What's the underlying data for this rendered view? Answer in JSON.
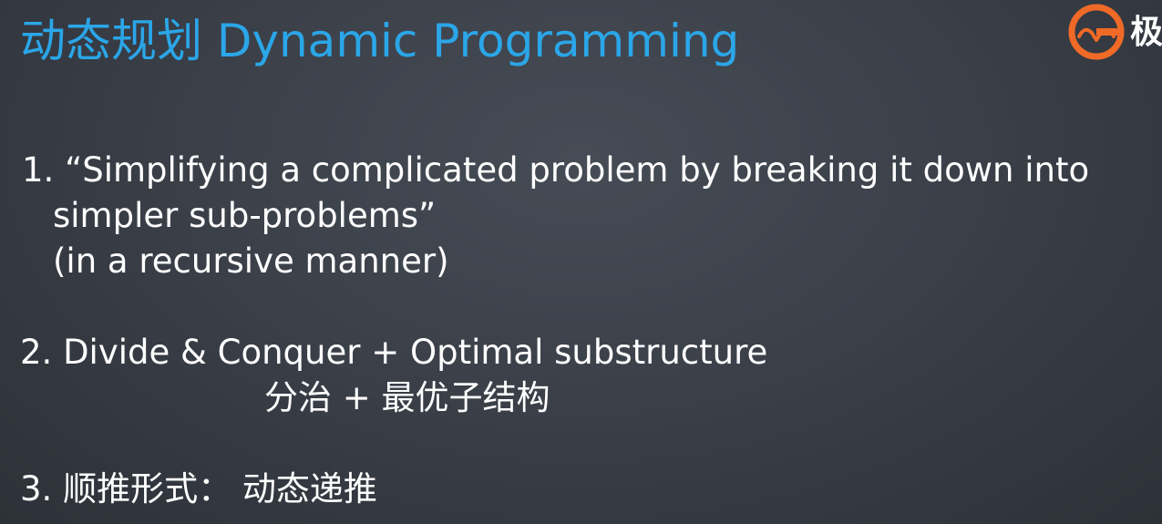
{
  "slide": {
    "title": "动态规划 Dynamic Programming",
    "logo": {
      "icon": "geekbang-logo-icon",
      "text": "极",
      "color": "#f06a27"
    },
    "points": [
      {
        "lines": [
          "1.  “Simplifying a complicated problem by breaking it down into",
          "simpler sub-problems”",
          "(in a recursive manner)"
        ]
      },
      {
        "lines": [
          "2. Divide & Conquer + Optimal substructure",
          "分治 + 最优子结构"
        ]
      },
      {
        "lines": [
          "3. 顺推形式：  动态递推"
        ]
      }
    ],
    "colors": {
      "title": "#2ba6e8",
      "text": "#ffffff",
      "background": "#3b4049"
    }
  }
}
